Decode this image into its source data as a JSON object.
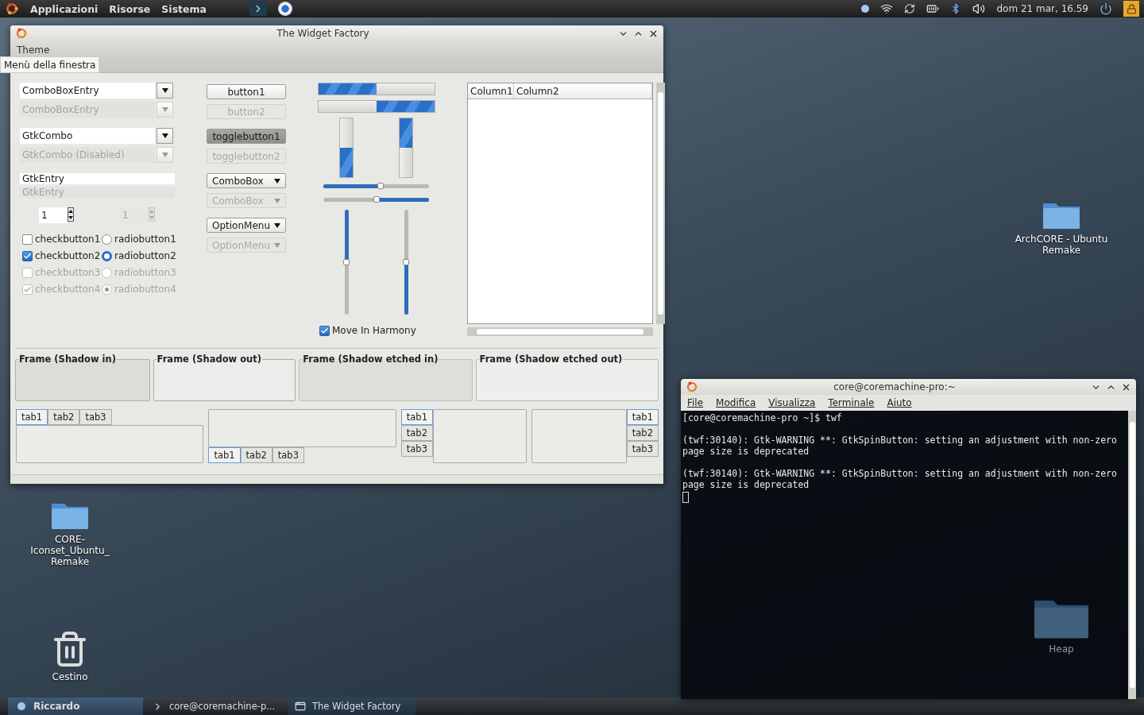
{
  "top_panel": {
    "menus": [
      "Applicazioni",
      "Risorse",
      "Sistema"
    ],
    "clock": "dom 21 mar, 16.59"
  },
  "widget_factory": {
    "title": "The Widget Factory",
    "menubar": [
      "Theme"
    ],
    "tooltip": "Menù della finestra",
    "combos": [
      {
        "value": "ComboBoxEntry",
        "disabled": false
      },
      {
        "value": "ComboBoxEntry",
        "disabled": true
      },
      {
        "value": "GtkCombo",
        "disabled": false
      },
      {
        "value": "GtkCombo (Disabled)",
        "disabled": true
      }
    ],
    "entries": [
      {
        "value": "GtkEntry",
        "disabled": false
      },
      {
        "value": "GtkEntry",
        "disabled": true
      }
    ],
    "spins": [
      {
        "value": "1",
        "disabled": false
      },
      {
        "value": "1",
        "disabled": true
      }
    ],
    "checks": [
      {
        "label": "checkbutton1",
        "checked": false,
        "disabled": false
      },
      {
        "label": "checkbutton2",
        "checked": true,
        "disabled": false
      },
      {
        "label": "checkbutton3",
        "checked": false,
        "disabled": true
      },
      {
        "label": "checkbutton4",
        "checked": true,
        "disabled": true
      }
    ],
    "radios": [
      {
        "label": "radiobutton1",
        "selected": false,
        "disabled": false
      },
      {
        "label": "radiobutton2",
        "selected": true,
        "disabled": false
      },
      {
        "label": "radiobutton3",
        "selected": false,
        "disabled": true
      },
      {
        "label": "radiobutton4",
        "selected": true,
        "disabled": true
      }
    ],
    "buttons": [
      {
        "label": "button1",
        "kind": "button",
        "active": false,
        "disabled": false
      },
      {
        "label": "button2",
        "kind": "button",
        "active": false,
        "disabled": true
      },
      {
        "label": "togglebutton1",
        "kind": "toggle",
        "active": true,
        "disabled": false
      },
      {
        "label": "togglebutton2",
        "kind": "toggle",
        "active": false,
        "disabled": true
      },
      {
        "label": "ComboBox",
        "kind": "dropdown",
        "active": false,
        "disabled": false
      },
      {
        "label": "ComboBox",
        "kind": "dropdown",
        "active": false,
        "disabled": true
      },
      {
        "label": "OptionMenu",
        "kind": "dropdown",
        "active": false,
        "disabled": false
      },
      {
        "label": "OptionMenu",
        "kind": "dropdown",
        "active": false,
        "disabled": true
      }
    ],
    "hprogress": [
      {
        "level": 0.5,
        "kind": "normal"
      },
      {
        "level": 0.5,
        "kind": "reversed"
      }
    ],
    "vprogress": [
      {
        "level": 0.5,
        "kind": "reversed"
      },
      {
        "level": 0.5,
        "kind": "normal"
      }
    ],
    "hscales": [
      {
        "level": 0.54,
        "kind": "normal"
      },
      {
        "level": 0.5,
        "kind": "reversed"
      }
    ],
    "vscales": [
      {
        "level": 0.5,
        "kind": "normal"
      },
      {
        "level": 0.5,
        "kind": "reversed"
      }
    ],
    "harmony": {
      "label": "Move In Harmony",
      "checked": true
    },
    "columns": [
      "Column1",
      "Column2"
    ],
    "frames": [
      {
        "label": "Frame (Shadow in)",
        "kind": "in"
      },
      {
        "label": "Frame (Shadow out)",
        "kind": "out"
      },
      {
        "label": "Frame (Shadow etched in)",
        "kind": "etchedin"
      },
      {
        "label": "Frame (Shadow etched out)",
        "kind": "etchedout"
      }
    ],
    "notebooks": [
      {
        "kind": "top",
        "tabs": [
          {
            "label": "tab1",
            "selected": true
          },
          {
            "label": "tab2",
            "selected": false
          },
          {
            "label": "tab3",
            "selected": false
          }
        ]
      },
      {
        "kind": "bottom",
        "tabs": [
          {
            "label": "tab1",
            "selected": true
          },
          {
            "label": "tab2",
            "selected": false
          },
          {
            "label": "tab3",
            "selected": false
          }
        ]
      },
      {
        "kind": "left",
        "tabs": [
          {
            "label": "tab1",
            "selected": true
          },
          {
            "label": "tab2",
            "selected": false
          },
          {
            "label": "tab3",
            "selected": false
          }
        ]
      },
      {
        "kind": "right",
        "tabs": [
          {
            "label": "tab1",
            "selected": true
          },
          {
            "label": "tab2",
            "selected": false
          },
          {
            "label": "tab3",
            "selected": false
          }
        ]
      }
    ]
  },
  "terminal": {
    "title": "core@coremachine-pro:~",
    "menus": [
      "File",
      "Modifica",
      "Visualizza",
      "Terminale",
      "Aiuto"
    ],
    "lines": [
      "[core@coremachine-pro ~]$ twf",
      "(twf:30140): Gtk-WARNING **: GtkSpinButton: setting an adjustment with non-zero page size is deprecated",
      "(twf:30140): Gtk-WARNING **: GtkSpinButton: setting an adjustment with non-zero page size is deprecated"
    ]
  },
  "desktop_icons": [
    {
      "label": "ArchCORE - Ubuntu Remake",
      "kind": "folder"
    },
    {
      "label": "CORE-Iconset_Ubuntu_ Remake",
      "kind": "folder"
    },
    {
      "label": "Cestino",
      "kind": "trash"
    },
    {
      "label": "Heap",
      "kind": "folder"
    }
  ],
  "taskbar": {
    "user": "Riccardo",
    "tasks": [
      {
        "label": "core@coremachine-p...",
        "kind": "terminal",
        "selected": false
      },
      {
        "label": "The Widget Factory",
        "kind": "window",
        "selected": true
      }
    ]
  }
}
